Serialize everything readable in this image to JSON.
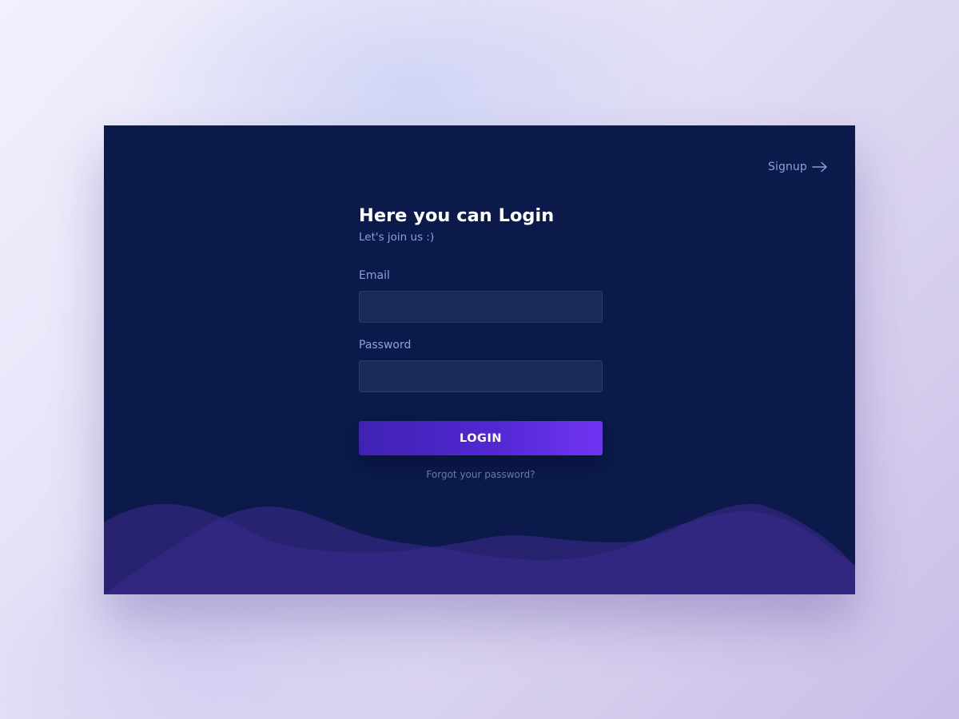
{
  "header": {
    "signup_label": "Signup",
    "signup_icon": "arrow-right-icon"
  },
  "form": {
    "title": "Here you can Login",
    "subtitle": "Let's join us :)",
    "email": {
      "label": "Email",
      "value": "",
      "placeholder": ""
    },
    "password": {
      "label": "Password",
      "value": "",
      "placeholder": ""
    },
    "login_label": "LOGIN",
    "forgot_label": "Forgot your password?"
  },
  "colors": {
    "card_background": "#0b1a4b",
    "accent_start": "#3f22b3",
    "accent_end": "#7034f3",
    "wave": "#3a2a8a",
    "muted_text": "#8fa0d8"
  }
}
